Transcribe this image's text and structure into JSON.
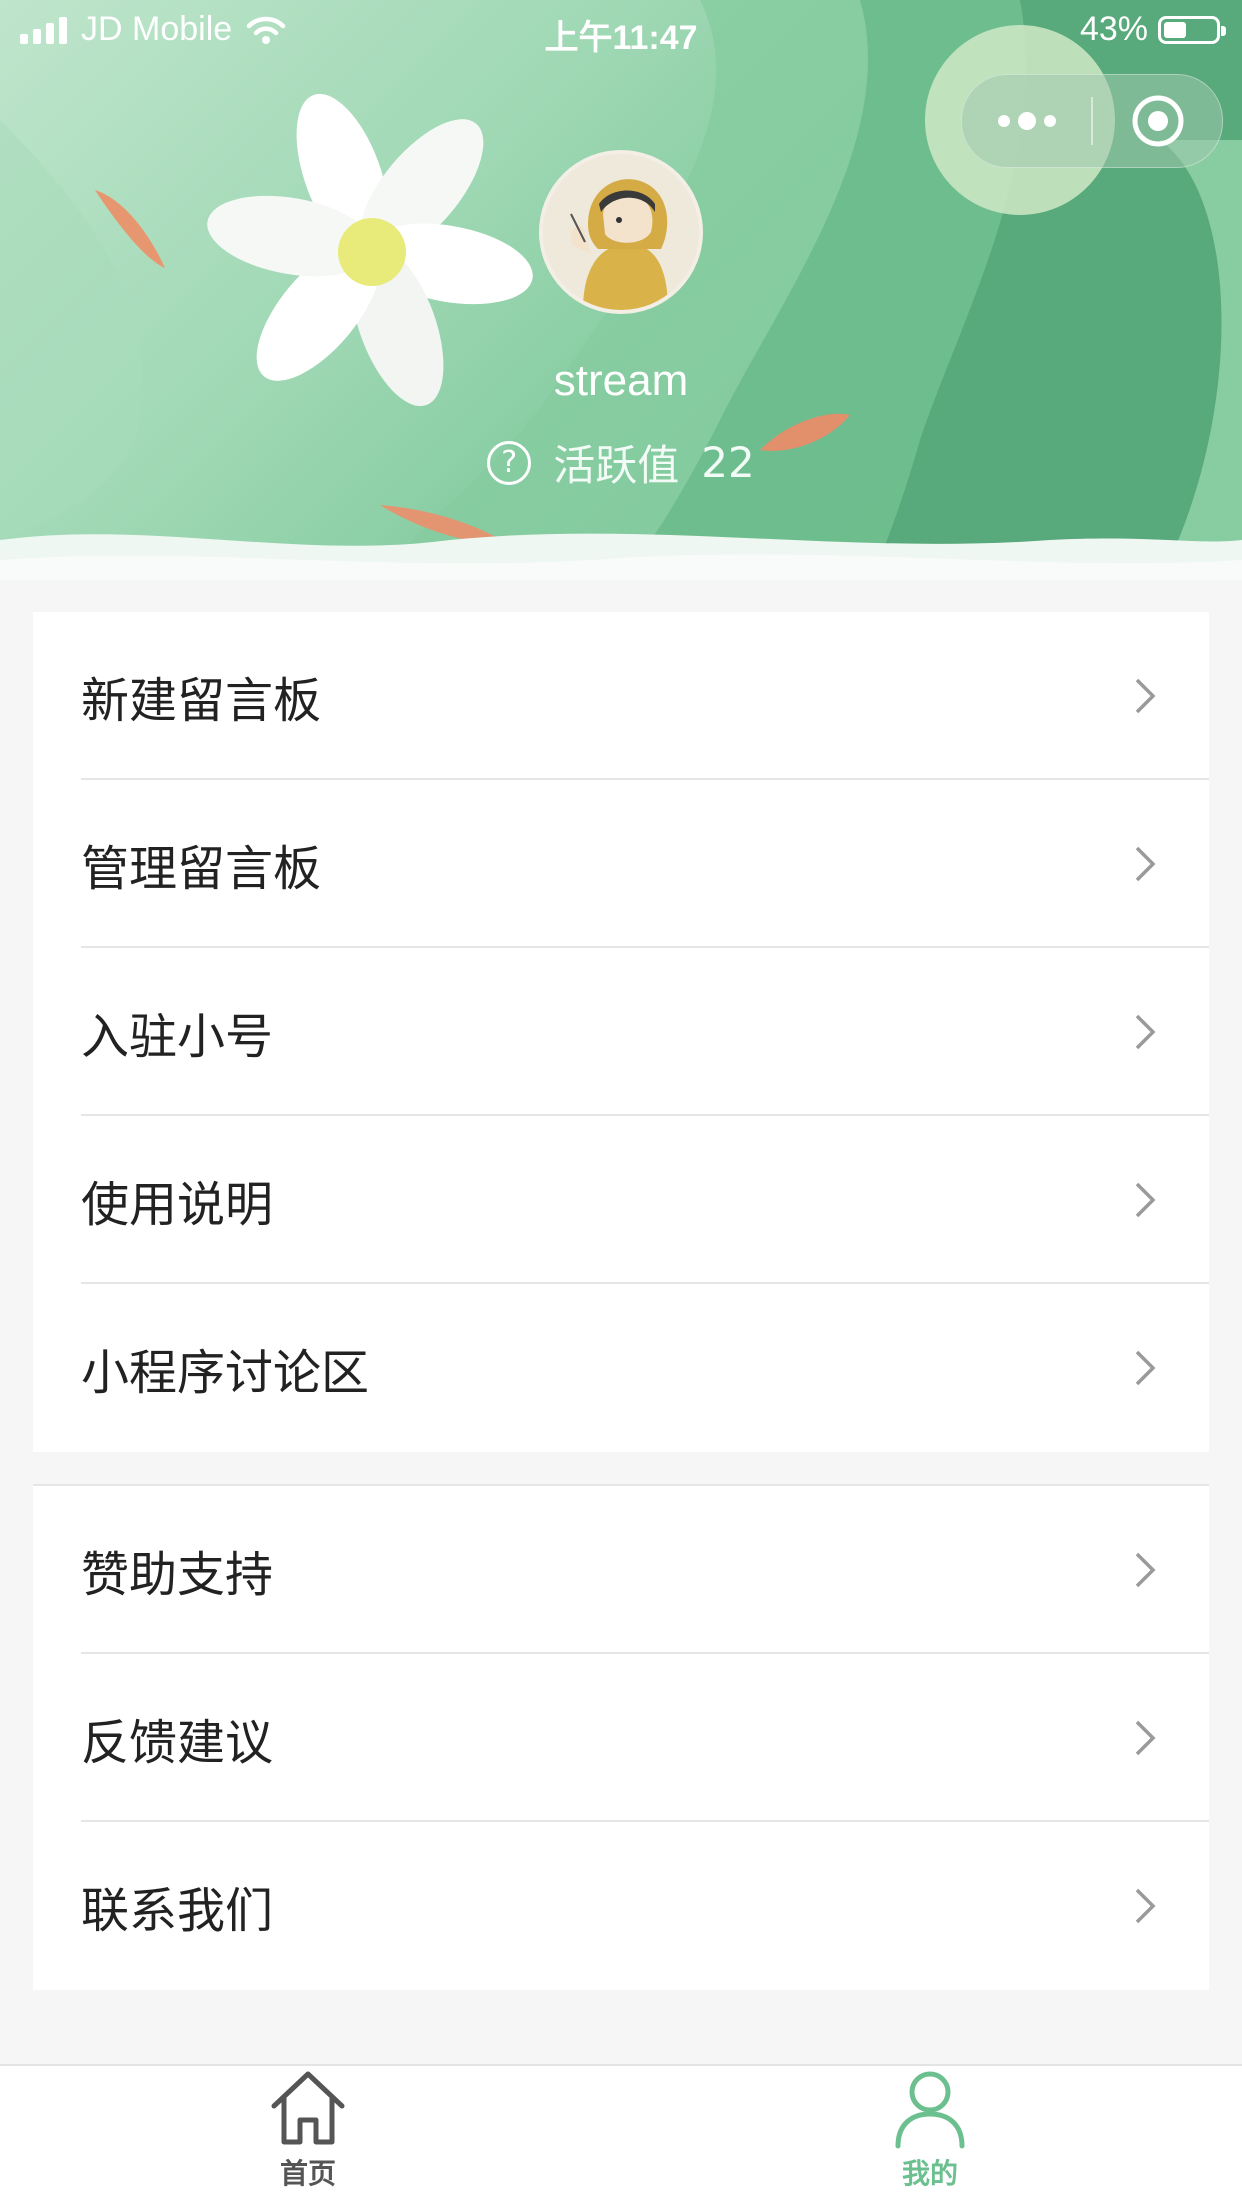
{
  "status_bar": {
    "carrier": "JD Mobile",
    "time": "上午11:47",
    "battery_percent": "43%",
    "battery_level": 0.43
  },
  "capsule": {
    "more_icon": "more-dots-icon",
    "close_icon": "target-circle-icon"
  },
  "profile": {
    "username": "stream",
    "activity_label": "活跃值",
    "activity_value": "22"
  },
  "menu_group_1": [
    {
      "label": "新建留言板"
    },
    {
      "label": "管理留言板"
    },
    {
      "label": "入驻小号"
    },
    {
      "label": "使用说明"
    },
    {
      "label": "小程序讨论区"
    }
  ],
  "menu_group_2": [
    {
      "label": "赞助支持"
    },
    {
      "label": "反馈建议"
    },
    {
      "label": "联系我们"
    }
  ],
  "tabbar": {
    "home_label": "首页",
    "mine_label": "我的",
    "active_color": "#6cc08f",
    "inactive_color": "#555555"
  }
}
